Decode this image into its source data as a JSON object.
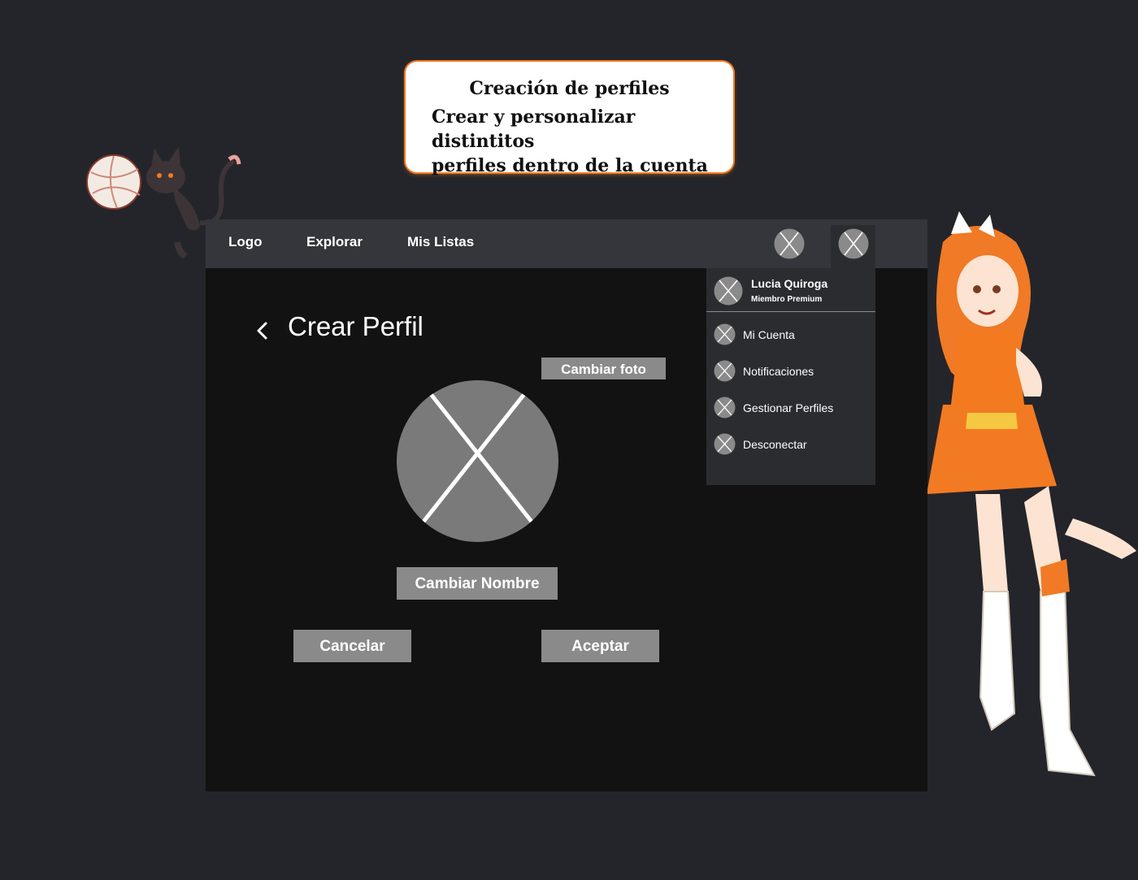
{
  "callout": {
    "title": "Creación de perfiles",
    "line1": "Crear y personalizar distintitos",
    "line2": "perfiles dentro de la cuenta"
  },
  "header": {
    "nav": [
      "Logo",
      "Explorar",
      "Mis Listas"
    ],
    "icons": [
      "placeholder-x-icon",
      "profile-avatar-icon"
    ]
  },
  "page": {
    "title": "Crear Perfil",
    "change_photo": "Cambiar foto",
    "change_name": "Cambiar Nombre",
    "cancel": "Cancelar",
    "accept": "Aceptar"
  },
  "menu": {
    "user_name": "Lucia Quiroga",
    "user_status": "Miembro Premium",
    "items": [
      "Mi Cuenta",
      "Notificaciones",
      "Gestionar Perfiles",
      "Desconectar"
    ]
  },
  "colors": {
    "page_bg": "#24252a",
    "header_bg": "#34363b",
    "content_bg": "#121212",
    "dropdown_bg": "#2b2c30",
    "button_gray": "#8a8a8a",
    "accent_orange": "#f07a25"
  }
}
